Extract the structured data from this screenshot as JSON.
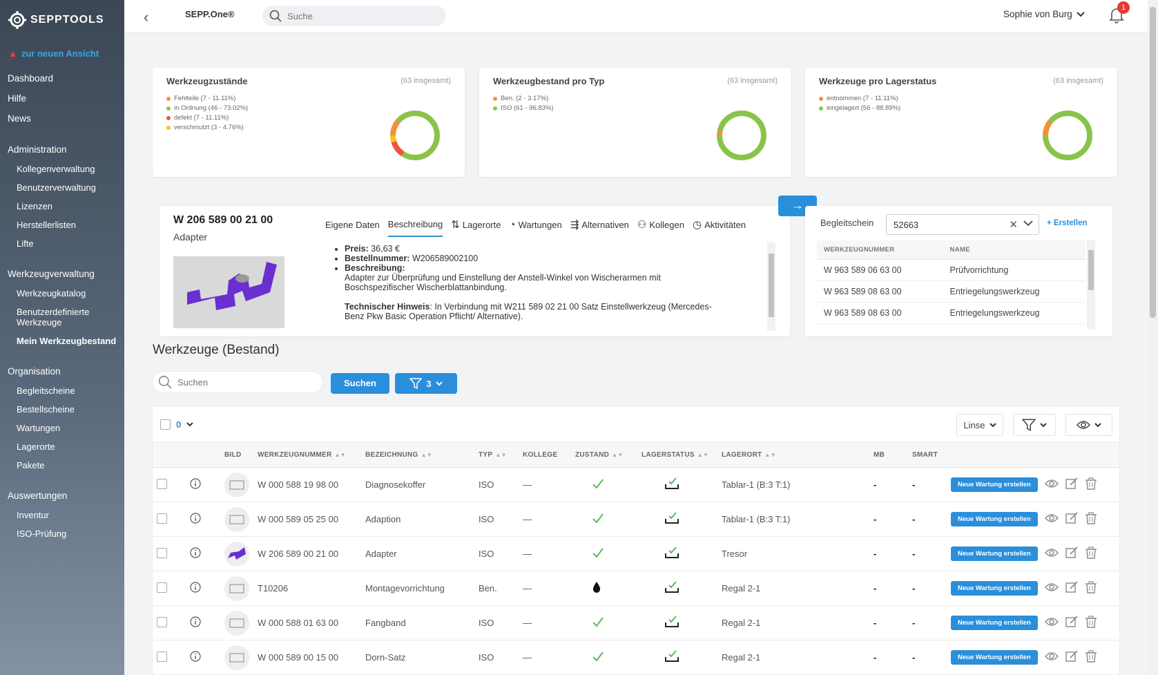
{
  "sidebar": {
    "logo_text": "SEPPTOOLS",
    "new_view": "zur neuen Ansicht",
    "items": [
      {
        "label": "Dashboard",
        "level": "top"
      },
      {
        "label": "Hilfe",
        "level": "top"
      },
      {
        "label": "News",
        "level": "top"
      },
      {
        "label": "Administration",
        "level": "top"
      },
      {
        "label": "Kollegenverwaltung",
        "level": "sub"
      },
      {
        "label": "Benutzerverwaltung",
        "level": "sub"
      },
      {
        "label": "Lizenzen",
        "level": "sub"
      },
      {
        "label": "Herstellerlisten",
        "level": "sub"
      },
      {
        "label": "Lifte",
        "level": "sub"
      },
      {
        "label": "Werkzeugverwaltung",
        "level": "top"
      },
      {
        "label": "Werkzeugkatalog",
        "level": "sub"
      },
      {
        "label": "Benutzerdefinierte Werkzeuge",
        "level": "sub"
      },
      {
        "label": "Mein Werkzeugbestand",
        "level": "sub",
        "active": true
      },
      {
        "label": "Organisation",
        "level": "top"
      },
      {
        "label": "Begleitscheine",
        "level": "sub"
      },
      {
        "label": "Bestellscheine",
        "level": "sub"
      },
      {
        "label": "Wartungen",
        "level": "sub"
      },
      {
        "label": "Lagerorte",
        "level": "sub"
      },
      {
        "label": "Pakete",
        "level": "sub"
      },
      {
        "label": "Auswertungen",
        "level": "top"
      },
      {
        "label": "Inventur",
        "level": "sub"
      },
      {
        "label": "ISO-Prüfung",
        "level": "sub"
      }
    ]
  },
  "topbar": {
    "brand": "SEPP.One®",
    "search_placeholder": "Suche",
    "user": "Sophie von Burg",
    "notifications": "1"
  },
  "stats": [
    {
      "title": "Werkzeugzustände",
      "total": "(63 insgesamt)",
      "legend": [
        {
          "label": "Fehlteile (7 - 11.11%)",
          "color": "#f0923a",
          "value": 7
        },
        {
          "label": "in Ordnung (46 - 73.02%)",
          "color": "#8bc34a",
          "value": 46
        },
        {
          "label": "defekt (7 - 11.11%)",
          "color": "#f0533a",
          "value": 7
        },
        {
          "label": "verschmutzt (3 - 4.76%)",
          "color": "#f5c518",
          "value": 3
        }
      ]
    },
    {
      "title": "Werkzeugbestand pro Typ",
      "total": "(63 insgesamt)",
      "legend": [
        {
          "label": "Ben. (2 - 3.17%)",
          "color": "#f0923a",
          "value": 2
        },
        {
          "label": "ISO (61 - 96.83%)",
          "color": "#8bc34a",
          "value": 61
        }
      ]
    },
    {
      "title": "Werkzeuge pro Lagerstatus",
      "total": "(63 insgesamt)",
      "legend": [
        {
          "label": "entnommen (7 - 11.11%)",
          "color": "#f0923a",
          "value": 7
        },
        {
          "label": "eingelagert (56 - 88.89%)",
          "color": "#8bc34a",
          "value": 56
        }
      ]
    }
  ],
  "detail": {
    "code": "W 206 589 00 21 00",
    "name": "Adapter",
    "tabs": [
      "Eigene Daten",
      "Beschreibung",
      "Lagerorte",
      "Wartungen",
      "Alternativen",
      "Kollegen",
      "Aktivitäten"
    ],
    "preis_label": "Preis:",
    "preis": "36,63 €",
    "bestell_label": "Bestellnummer:",
    "bestell": "W206589002100",
    "beschr_label": "Beschreibung:",
    "beschr": "Adapter zur Überprüfung und Einstellung der Anstell-Winkel von Wischerarmen mit Boschspezifischer Wischerblattanbindung.",
    "hint_label": "Technischer Hinweis",
    "hint": ": In Verbindung mit W211 589 02 21 00 Satz Einstellwerkzeug (Mercedes-Benz Pkw Basic Operation Pflicht/ Alternative)."
  },
  "begleitschein": {
    "label": "Begleitschein",
    "value": "52663",
    "create": "+ Erstellen",
    "headers": [
      "WERKZEUGNUMMER",
      "NAME"
    ],
    "rows": [
      [
        "W 963 589 06 63 00",
        "Prüfvorrichtung"
      ],
      [
        "W 963 589 08 63 00",
        "Entriegelungswerkzeug"
      ],
      [
        "W 963 589 08 63 00",
        "Entriegelungswerkzeug"
      ]
    ]
  },
  "tools": {
    "title": "Werkzeuge (Bestand)",
    "search_placeholder": "Suchen",
    "search_btn": "Suchen",
    "filter_count": "3",
    "selected_count": "0",
    "view_label": "Linse",
    "headers": [
      "BILD",
      "WERKZEUGNUMMER",
      "BEZEICHNUNG",
      "TYP",
      "KOLLEGE",
      "ZUSTAND",
      "LAGERSTATUS",
      "LAGERORT",
      "MB",
      "SMART"
    ],
    "maint_btn": "Neue Wartung erstellen",
    "rows": [
      {
        "nr": "W 000 588 19 98 00",
        "bez": "Diagnosekoffer",
        "typ": "ISO",
        "kollege": "—",
        "zustand": "ok",
        "lagerort": "Tablar-1 (B:3 T:1)",
        "mb": "-",
        "smart": "-"
      },
      {
        "nr": "W 000 589 05 25 00",
        "bez": "Adaption",
        "typ": "ISO",
        "kollege": "—",
        "zustand": "ok",
        "lagerort": "Tablar-1 (B:3 T:1)",
        "mb": "-",
        "smart": "-"
      },
      {
        "nr": "W 206 589 00 21 00",
        "bez": "Adapter",
        "typ": "ISO",
        "kollege": "—",
        "zustand": "ok",
        "lagerort": "Tresor",
        "mb": "-",
        "smart": "-"
      },
      {
        "nr": "T10206",
        "bez": "Montagevorrichtung",
        "typ": "Ben.",
        "kollege": "—",
        "zustand": "dirty",
        "lagerort": "Regal 2-1",
        "mb": "-",
        "smart": "-"
      },
      {
        "nr": "W 000 588 01 63 00",
        "bez": "Fangband",
        "typ": "ISO",
        "kollege": "—",
        "zustand": "ok",
        "lagerort": "Regal 2-1",
        "mb": "-",
        "smart": "-"
      },
      {
        "nr": "W 000 589 00 15 00",
        "bez": "Dorn-Satz",
        "typ": "ISO",
        "kollege": "—",
        "zustand": "ok",
        "lagerort": "Regal 2-1",
        "mb": "-",
        "smart": "-"
      }
    ]
  }
}
